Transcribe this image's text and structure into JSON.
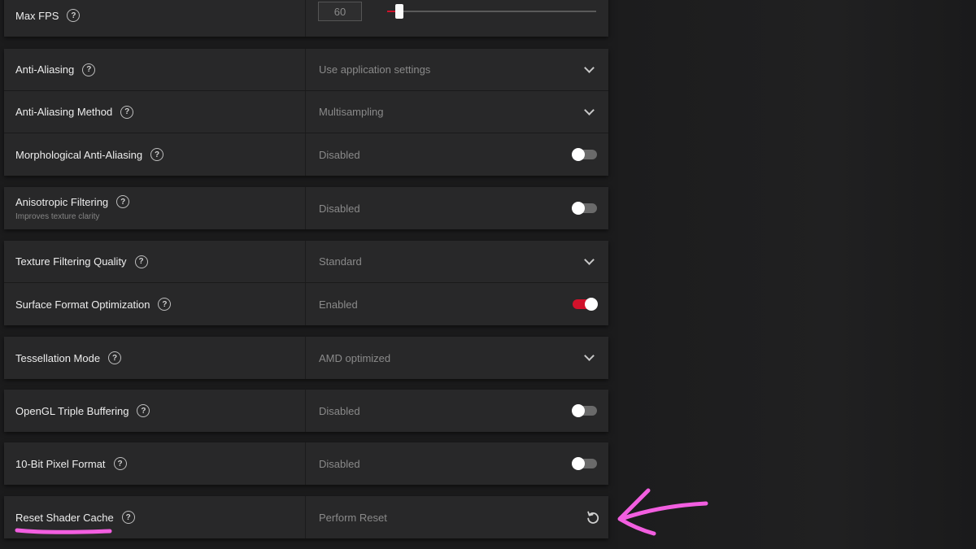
{
  "colors": {
    "accent": "#d1122b",
    "annotation": "#f25ee0"
  },
  "max_fps": {
    "label": "Max FPS",
    "value": "60",
    "slider_fraction": 0.06,
    "help_icon": "question-circle-icon"
  },
  "settings": [
    {
      "label": "Anti-Aliasing",
      "value": "Use application settings",
      "control": "dropdown"
    },
    {
      "label": "Anti-Aliasing Method",
      "value": "Multisampling",
      "control": "dropdown"
    },
    {
      "label": "Morphological Anti-Aliasing",
      "value": "Disabled",
      "control": "toggle",
      "on": false
    },
    {
      "label": "Anisotropic Filtering",
      "sublabel": "Improves texture clarity",
      "value": "Disabled",
      "control": "toggle",
      "on": false
    },
    {
      "label": "Texture Filtering Quality",
      "value": "Standard",
      "control": "dropdown"
    },
    {
      "label": "Surface Format Optimization",
      "value": "Enabled",
      "control": "toggle",
      "on": true
    },
    {
      "label": "Tessellation Mode",
      "value": "AMD optimized",
      "control": "dropdown"
    },
    {
      "label": "OpenGL Triple Buffering",
      "value": "Disabled",
      "control": "toggle",
      "on": false
    },
    {
      "label": "10-Bit Pixel Format",
      "value": "Disabled",
      "control": "toggle",
      "on": false
    },
    {
      "label": "Reset Shader Cache",
      "value": "Perform Reset",
      "control": "reset-icon"
    }
  ],
  "help_glyph": "?"
}
